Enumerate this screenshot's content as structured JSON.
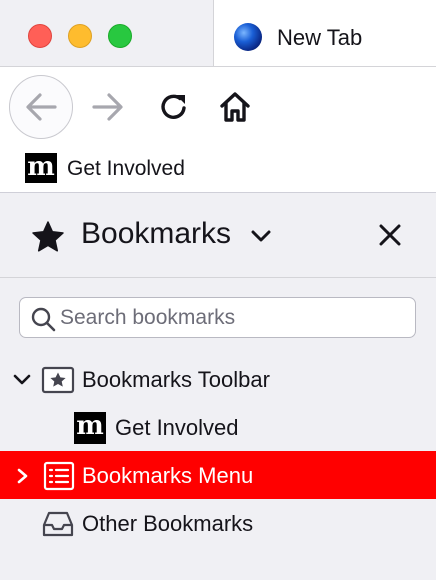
{
  "tab": {
    "title": "New Tab"
  },
  "bookmarks_toolbar": {
    "item_label": "Get Involved"
  },
  "sidebar": {
    "title": "Bookmarks",
    "search_placeholder": "Search bookmarks",
    "tree": [
      {
        "label": "Bookmarks Toolbar",
        "expanded": true,
        "icon": "star-folder-icon"
      },
      {
        "label": "Get Involved",
        "icon": "m-logo-icon"
      },
      {
        "label": "Bookmarks Menu",
        "expanded": false,
        "selected": true,
        "icon": "menu-list-icon"
      },
      {
        "label": "Other Bookmarks",
        "icon": "tray-icon"
      }
    ]
  },
  "colors": {
    "selection": "#ff0000",
    "traffic_close": "#ff5f57",
    "traffic_min": "#febc2e",
    "traffic_max": "#28c840",
    "sidebar_bg": "#f0f0f4"
  }
}
